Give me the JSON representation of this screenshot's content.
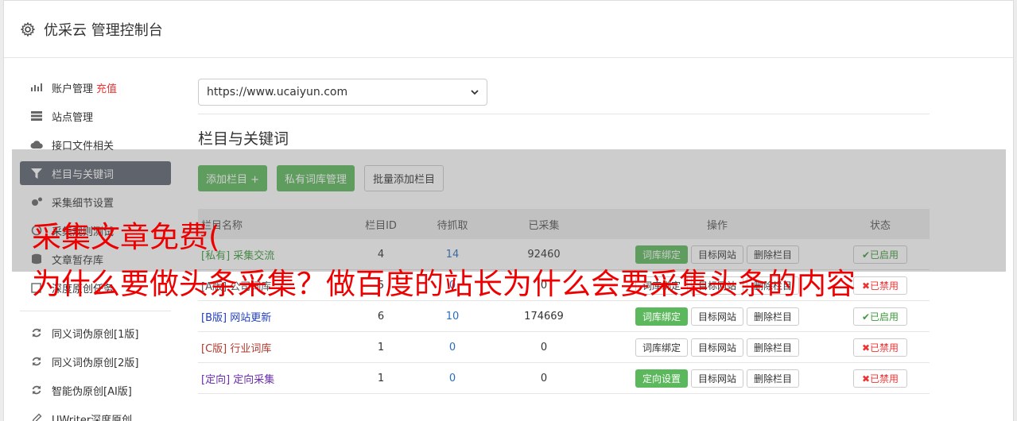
{
  "header": {
    "title": "优采云 管理控制台",
    "icon": "gear-icon"
  },
  "sidebar": {
    "items": [
      {
        "label": "账户管理",
        "accent": "充值",
        "icon": "bar-chart-icon"
      },
      {
        "label": "站点管理",
        "icon": "server-icon"
      },
      {
        "label": "接口文件相关",
        "icon": "cloud-upload-icon"
      },
      {
        "label": "栏目与关键词",
        "icon": "filter-icon",
        "active": true
      },
      {
        "label": "采集细节设置",
        "icon": "gears-icon"
      },
      {
        "label": "采集规则测试",
        "icon": "test-icon"
      },
      {
        "label": "文章暂存库",
        "icon": "database-icon"
      },
      {
        "label": "深度原创任务",
        "icon": "edit-icon"
      }
    ],
    "items2": [
      {
        "label": "同义词伪原创[1版]",
        "icon": "refresh-icon"
      },
      {
        "label": "同义词伪原创[2版]",
        "icon": "refresh-icon"
      },
      {
        "label": "智能伪原创[AI版]",
        "icon": "refresh-icon"
      },
      {
        "label": "UWriter深度原创",
        "icon": "pencil-icon"
      }
    ]
  },
  "main": {
    "site_select": "https://www.ucaiyun.com",
    "section_title": "栏目与关键词",
    "buttons": {
      "add_column": "添加栏目 +",
      "private_lib": "私有词库管理",
      "batch_add": "批量添加栏目"
    },
    "table": {
      "headers": {
        "name": "栏目名称",
        "id": "栏目ID",
        "pending": "待抓取",
        "collected": "已采集",
        "ops": "操作",
        "status": "状态"
      },
      "rows": [
        {
          "tag": "[私有]",
          "name": "采集交流",
          "id": "4",
          "pending": "14",
          "collected": "92460",
          "op1": "词库绑定",
          "op2": "目标网站",
          "op3": "删除栏目",
          "status": "✔已启用",
          "color": "#3c9a3c"
        },
        {
          "tag": "[A版]",
          "name": "公司词库",
          "id": "5",
          "pending": "0",
          "collected": "0",
          "op1": "词库绑定",
          "op2": "目标网站",
          "op3": "删除栏目",
          "status": "✖已禁用",
          "color": "#555555"
        },
        {
          "tag": "[B版]",
          "name": "网站更新",
          "id": "6",
          "pending": "10",
          "collected": "174669",
          "op1": "词库绑定",
          "op2": "目标网站",
          "op3": "删除栏目",
          "status": "✔已启用",
          "color": "#1f3fbf"
        },
        {
          "tag": "[C版]",
          "name": "行业词库",
          "id": "1",
          "pending": "0",
          "collected": "0",
          "op1": "词库绑定",
          "op2": "目标网站",
          "op3": "删除栏目",
          "status": "✖已禁用",
          "color": "#b03a2e"
        },
        {
          "tag": "[定向]",
          "name": "定向采集",
          "id": "1",
          "pending": "0",
          "collected": "0",
          "op1": "定向设置",
          "op2": "目标网站",
          "op3": "删除栏目",
          "status": "✖已禁用",
          "color": "#6a2cb0"
        }
      ]
    }
  },
  "overlay": {
    "line1": "采集文章免费(",
    "line2": "为什么要做头条采集？做百度的站长为什么会要采集头条的内容"
  }
}
